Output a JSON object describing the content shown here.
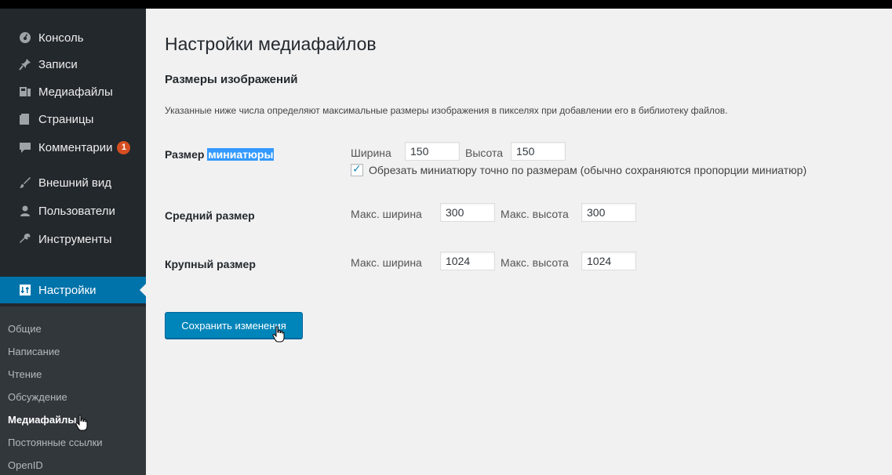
{
  "sidebar": {
    "items": [
      {
        "label": "Консоль",
        "icon": "dashboard-icon"
      },
      {
        "label": "Записи",
        "icon": "pin-icon"
      },
      {
        "label": "Медиафайлы",
        "icon": "media-icon"
      },
      {
        "label": "Страницы",
        "icon": "page-icon"
      },
      {
        "label": "Комментарии",
        "icon": "comment-icon",
        "badge": "1"
      },
      {
        "label": "Внешний вид",
        "icon": "appearance-icon"
      },
      {
        "label": "Пользователи",
        "icon": "users-icon"
      },
      {
        "label": "Инструменты",
        "icon": "tools-icon"
      },
      {
        "label": "Настройки",
        "icon": "settings-icon",
        "active": true
      }
    ],
    "submenu": [
      {
        "label": "Общие"
      },
      {
        "label": "Написание"
      },
      {
        "label": "Чтение"
      },
      {
        "label": "Обсуждение"
      },
      {
        "label": "Медиафайлы",
        "current": true
      },
      {
        "label": "Постоянные ссылки"
      },
      {
        "label": "OpenID"
      }
    ]
  },
  "main": {
    "title": "Настройки медиафайлов",
    "section_title": "Размеры изображений",
    "description": "Указанные ниже числа определяют максимальные размеры изображения в пикселях при добавлении его в библиотеку файлов.",
    "thumbnail": {
      "label_prefix": "Размер ",
      "label_highlight": "миниатюры",
      "width_label": "Ширина",
      "width": "150",
      "height_label": "Высота",
      "height": "150",
      "crop_label": "Обрезать миниатюру точно по размерам (обычно сохраняются пропорции миниатюр)",
      "crop_checked": true
    },
    "medium": {
      "label": "Средний размер",
      "width_label": "Макс. ширина",
      "width": "300",
      "height_label": "Макс. высота",
      "height": "300"
    },
    "large": {
      "label": "Крупный размер",
      "width_label": "Макс. ширина",
      "width": "1024",
      "height_label": "Макс. высота",
      "height": "1024"
    },
    "save_label": "Сохранить изменения"
  },
  "colors": {
    "sidebar_bg": "#23282d",
    "submenu_bg": "#32373c",
    "accent": "#0073aa",
    "button": "#0085ba",
    "badge": "#d54e21",
    "highlight": "#3399ff"
  }
}
